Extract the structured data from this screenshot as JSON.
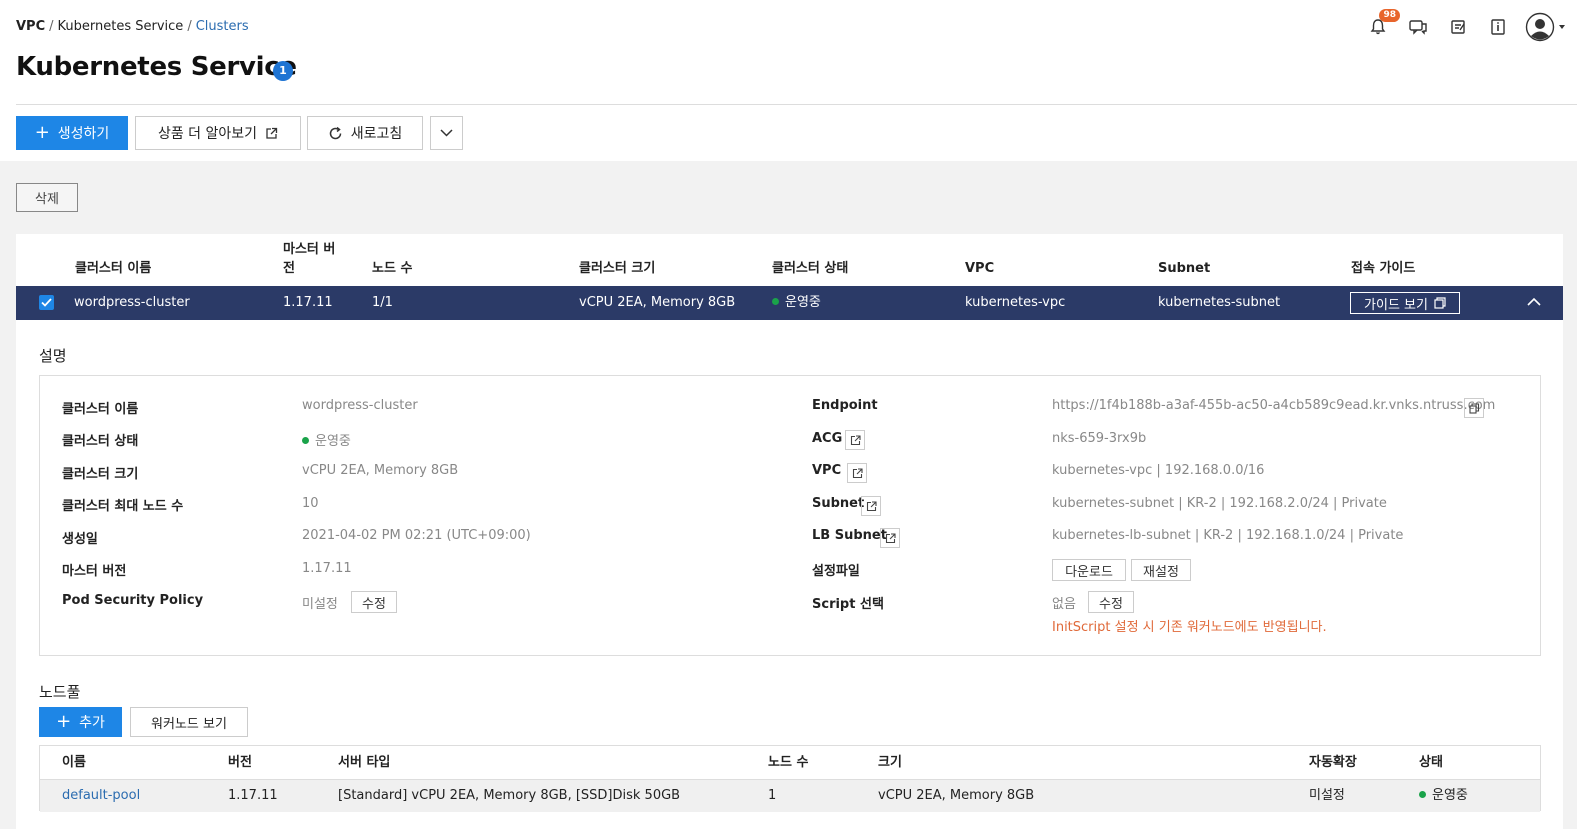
{
  "breadcrumb": [
    "VPC",
    "Kubernetes Service",
    "Clusters"
  ],
  "page_title": "Kubernetes Service",
  "info_badge": "1",
  "header": {
    "notification_count": "98"
  },
  "toolbar": {
    "create_label": "생성하기",
    "learn_more_label": "상품 더 알아보기",
    "refresh_label": "새로고침",
    "delete_label": "삭제"
  },
  "cluster_table": {
    "headers": {
      "name": "클러스터 이름",
      "master_version_l1": "마스터 버",
      "master_version_l2": "전",
      "node_count": "노드 수",
      "size": "클러스터 크기",
      "status": "클러스터 상태",
      "vpc": "VPC",
      "subnet": "Subnet",
      "guide": "접속 가이드"
    },
    "row": {
      "name": "wordpress-cluster",
      "master_version": "1.17.11",
      "node_count": "1/1",
      "size": "vCPU 2EA, Memory 8GB",
      "status": "운영중",
      "vpc": "kubernetes-vpc",
      "subnet": "kubernetes-subnet",
      "guide_button": "가이드 보기"
    }
  },
  "detail": {
    "title": "설명",
    "left": [
      {
        "label": "클러스터 이름",
        "value": "wordpress-cluster"
      },
      {
        "label": "클러스터 상태",
        "value": "운영중"
      },
      {
        "label": "클러스터 크기",
        "value": "vCPU 2EA, Memory 8GB"
      },
      {
        "label": "클러스터 최대 노드 수",
        "value": "10"
      },
      {
        "label": "생성일",
        "value": "2021-04-02 PM 02:21 (UTC+09:00)"
      },
      {
        "label": "마스터 버전",
        "value": "1.17.11"
      },
      {
        "label": "Pod Security Policy",
        "value": "미설정",
        "button": "수정"
      }
    ],
    "right": [
      {
        "label": "Endpoint",
        "value": "https://1f4b188b-a3af-455b-ac50-a4cb589c9ead.kr.vnks.ntruss.com"
      },
      {
        "label": "ACG",
        "value": "nks-659-3rx9b"
      },
      {
        "label": "VPC",
        "value": "kubernetes-vpc | 192.168.0.0/16"
      },
      {
        "label": "Subnet",
        "value": "kubernetes-subnet | KR-2 | 192.168.2.0/24 | Private"
      },
      {
        "label": "LB Subnet",
        "value": "kubernetes-lb-subnet | KR-2 | 192.168.1.0/24 | Private"
      },
      {
        "label": "설정파일",
        "download": "다운로드",
        "reset": "재설정"
      },
      {
        "label": "Script 선택",
        "value": "없음",
        "button": "수정",
        "warning": "InitScript 설정 시 기존 워커노드에도 반영됩니다."
      }
    ]
  },
  "nodepool": {
    "title": "노드풀",
    "add_label": "추가",
    "view_workers_label": "워커노드 보기",
    "headers": [
      "이름",
      "버전",
      "서버 타입",
      "노드 수",
      "크기",
      "자동확장",
      "상태"
    ],
    "rows": [
      {
        "name": "default-pool",
        "version": "1.17.11",
        "server_type": "[Standard] vCPU 2EA, Memory 8GB, [SSD]Disk 50GB",
        "node_count": "1",
        "size": "vCPU 2EA, Memory 8GB",
        "autoscale": "미설정",
        "status": "운영중"
      }
    ]
  },
  "colors": {
    "primary": "#1e86e6",
    "selected_row": "#2b3a67",
    "running": "#1aa34a",
    "warning": "#e06a3a",
    "badge": "#e8652c"
  }
}
